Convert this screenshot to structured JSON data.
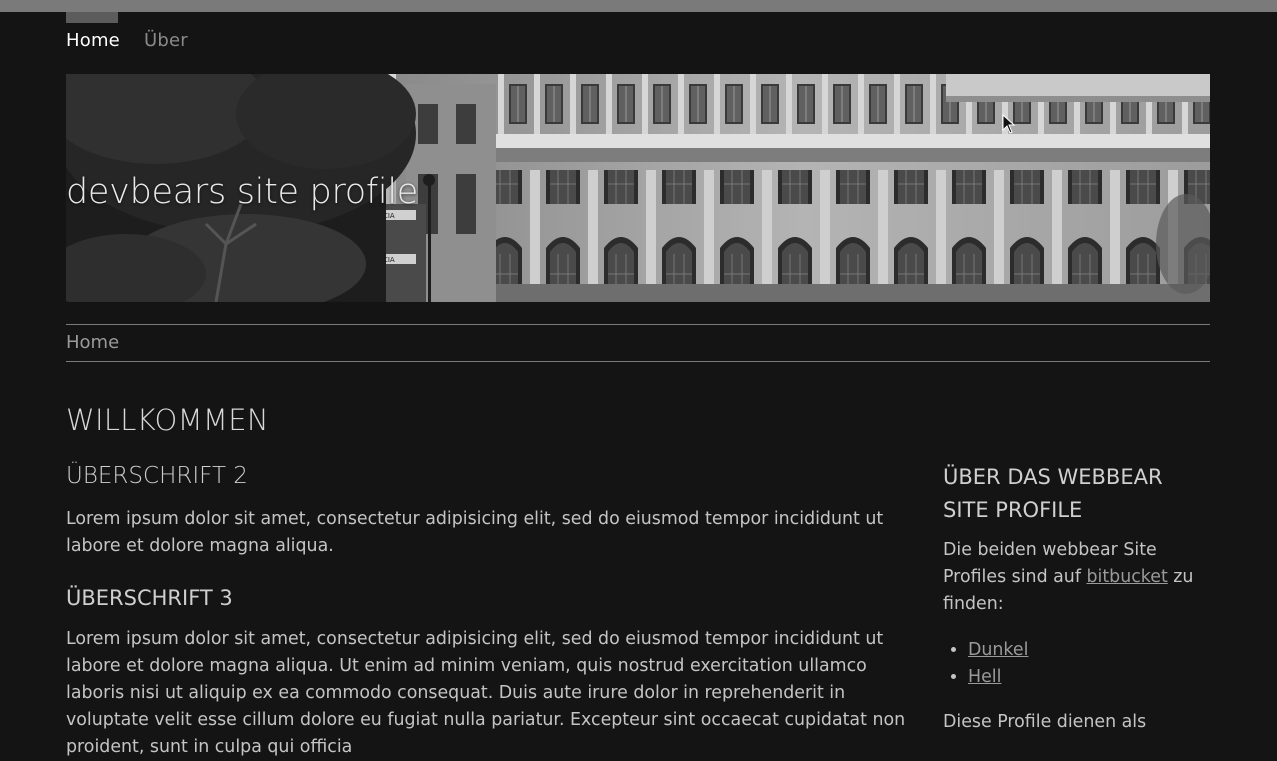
{
  "nav": {
    "items": [
      {
        "label": "Home",
        "active": true
      },
      {
        "label": "Über",
        "active": false
      }
    ]
  },
  "hero": {
    "title": "devbears site profile",
    "image": "black-and-white-colonial-building-photo",
    "signs": [
      "POLICIA",
      "POLICIA"
    ]
  },
  "breadcrumb": {
    "label": "Home"
  },
  "main": {
    "heading": "WILLKOMMEN",
    "section1": {
      "heading": "ÜBERSCHRIFT 2",
      "text": "Lorem ipsum dolor sit amet, consectetur adipisicing elit, sed do eiusmod tempor incididunt ut labore et dolore magna aliqua."
    },
    "section2": {
      "heading": "ÜBERSCHRIFT 3",
      "text": "Lorem ipsum dolor sit amet, consectetur adipisicing elit, sed do eiusmod tempor incididunt ut labore et dolore magna aliqua. Ut enim ad minim veniam, quis nostrud exercitation ullamco laboris nisi ut aliquip ex ea commodo consequat. Duis aute irure dolor in reprehenderit in voluptate velit esse cillum dolore eu fugiat nulla pariatur. Excepteur sint occaecat cupidatat non proident, sunt in culpa qui officia"
    }
  },
  "aside": {
    "title": "ÜBER DAS WEBBEAR SITE PROFILE",
    "text_before": "Die beiden webbear Site Profiles sind auf ",
    "link": "bitbucket",
    "text_after": " zu finden:",
    "list": [
      "Dunkel",
      "Hell"
    ],
    "text2": "Diese Profile dienen als"
  },
  "colors": {
    "background": "#141414",
    "topbar": "#7a7a7a",
    "text": "#c4c4c4",
    "link": "#9a9a9a"
  }
}
